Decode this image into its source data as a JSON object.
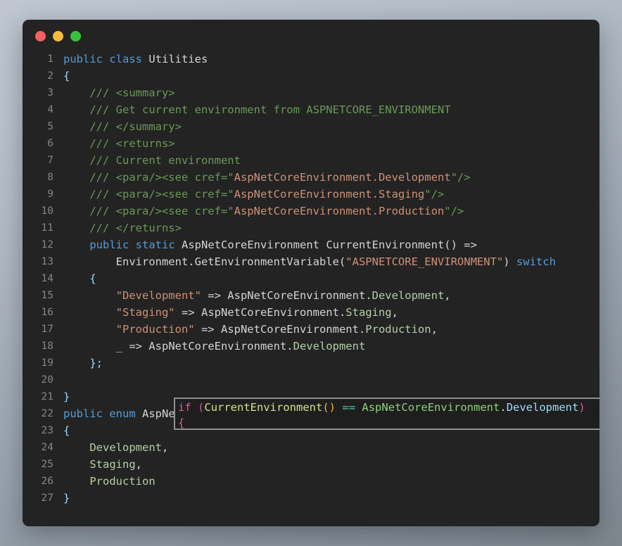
{
  "window": {
    "name": "code-snippet-window",
    "traffic_lights": [
      {
        "name": "close-button",
        "color": "#f1605f"
      },
      {
        "name": "minimize-button",
        "color": "#f5bd3a"
      },
      {
        "name": "maximize-button",
        "color": "#39c13c"
      }
    ],
    "background": "#232323"
  },
  "theme": {
    "background": "#232323",
    "gutter": "#858585",
    "text": "#d4d4d4",
    "keyword": "#569cd6",
    "comment": "#6a9955",
    "string": "#ce9178",
    "enum_member": "#b5cea8",
    "parameter": "#9cdcfe"
  },
  "editor": {
    "language": "csharp",
    "first_line_number": 1,
    "last_line_number": 27,
    "lines": [
      {
        "n": "1",
        "tokens": [
          {
            "t": "public",
            "c": "k"
          },
          {
            "t": " ",
            "c": "op"
          },
          {
            "t": "class",
            "c": "k"
          },
          {
            "t": " ",
            "c": "op"
          },
          {
            "t": "Utilities",
            "c": "ty"
          }
        ]
      },
      {
        "n": "2",
        "tokens": [
          {
            "t": "{",
            "c": "pn"
          }
        ]
      },
      {
        "n": "3",
        "tokens": [
          {
            "t": "    /// ",
            "c": "cm"
          },
          {
            "t": "<summary>",
            "c": "cm"
          }
        ]
      },
      {
        "n": "4",
        "tokens": [
          {
            "t": "    /// Get current environment from ASPNETCORE_ENVIRONMENT",
            "c": "cm"
          }
        ]
      },
      {
        "n": "5",
        "tokens": [
          {
            "t": "    /// </summary>",
            "c": "cm"
          }
        ]
      },
      {
        "n": "6",
        "tokens": [
          {
            "t": "    /// <returns>",
            "c": "cm"
          }
        ]
      },
      {
        "n": "7",
        "tokens": [
          {
            "t": "    /// Current environment",
            "c": "cm"
          }
        ]
      },
      {
        "n": "8",
        "tokens": [
          {
            "t": "    /// <para/><see cref=\"",
            "c": "cm"
          },
          {
            "t": "AspNetCoreEnvironment.Development",
            "c": "str"
          },
          {
            "t": "\"/>",
            "c": "cm"
          }
        ]
      },
      {
        "n": "9",
        "tokens": [
          {
            "t": "    /// <para/><see cref=\"",
            "c": "cm"
          },
          {
            "t": "AspNetCoreEnvironment.Staging",
            "c": "str"
          },
          {
            "t": "\"/>",
            "c": "cm"
          }
        ]
      },
      {
        "n": "10",
        "tokens": [
          {
            "t": "    /// <para/><see cref=\"",
            "c": "cm"
          },
          {
            "t": "AspNetCoreEnvironment.Production",
            "c": "str"
          },
          {
            "t": "\"/>",
            "c": "cm"
          }
        ]
      },
      {
        "n": "11",
        "tokens": [
          {
            "t": "    /// </returns>",
            "c": "cm"
          }
        ]
      },
      {
        "n": "12",
        "tokens": [
          {
            "t": "    ",
            "c": "op"
          },
          {
            "t": "public",
            "c": "k"
          },
          {
            "t": " ",
            "c": "op"
          },
          {
            "t": "static",
            "c": "k"
          },
          {
            "t": " ",
            "c": "op"
          },
          {
            "t": "AspNetCoreEnvironment CurrentEnvironment() =>",
            "c": "ty"
          }
        ]
      },
      {
        "n": "13",
        "tokens": [
          {
            "t": "        Environment.GetEnvironmentVariable(",
            "c": "ty"
          },
          {
            "t": "\"ASPNETCORE_ENVIRONMENT\"",
            "c": "str"
          },
          {
            "t": ") ",
            "c": "ty"
          },
          {
            "t": "switch",
            "c": "k"
          }
        ]
      },
      {
        "n": "14",
        "tokens": [
          {
            "t": "    ",
            "c": "op"
          },
          {
            "t": "{",
            "c": "pn"
          }
        ]
      },
      {
        "n": "15",
        "tokens": [
          {
            "t": "        ",
            "c": "op"
          },
          {
            "t": "\"Development\"",
            "c": "str"
          },
          {
            "t": " => AspNetCoreEnvironment.",
            "c": "ty"
          },
          {
            "t": "Development",
            "c": "enm"
          },
          {
            "t": ",",
            "c": "ty"
          }
        ]
      },
      {
        "n": "16",
        "tokens": [
          {
            "t": "        ",
            "c": "op"
          },
          {
            "t": "\"Staging\"",
            "c": "str"
          },
          {
            "t": " => AspNetCoreEnvironment.",
            "c": "ty"
          },
          {
            "t": "Staging",
            "c": "enm"
          },
          {
            "t": ",",
            "c": "ty"
          }
        ]
      },
      {
        "n": "17",
        "tokens": [
          {
            "t": "        ",
            "c": "op"
          },
          {
            "t": "\"Production\"",
            "c": "str"
          },
          {
            "t": " => AspNetCoreEnvironment.",
            "c": "ty"
          },
          {
            "t": "Production",
            "c": "enm"
          },
          {
            "t": ",",
            "c": "ty"
          }
        ]
      },
      {
        "n": "18",
        "tokens": [
          {
            "t": "        ",
            "c": "op"
          },
          {
            "t": "_",
            "c": "pn"
          },
          {
            "t": " => AspNetCoreEnvironment.",
            "c": "ty"
          },
          {
            "t": "Development",
            "c": "enm"
          }
        ]
      },
      {
        "n": "19",
        "tokens": [
          {
            "t": "    };",
            "c": "pn"
          }
        ]
      },
      {
        "n": "20",
        "tokens": [
          {
            "t": " ",
            "c": "op"
          }
        ]
      },
      {
        "n": "21",
        "tokens": [
          {
            "t": "}",
            "c": "pn"
          }
        ]
      },
      {
        "n": "22",
        "tokens": [
          {
            "t": "public",
            "c": "k"
          },
          {
            "t": " ",
            "c": "op"
          },
          {
            "t": "enum",
            "c": "k"
          },
          {
            "t": " ",
            "c": "op"
          },
          {
            "t": "AspNetCoreEnvironment",
            "c": "ty"
          }
        ]
      },
      {
        "n": "23",
        "tokens": [
          {
            "t": "{",
            "c": "pn"
          }
        ]
      },
      {
        "n": "24",
        "tokens": [
          {
            "t": "    ",
            "c": "op"
          },
          {
            "t": "Development",
            "c": "enm"
          },
          {
            "t": ",",
            "c": "ty"
          }
        ]
      },
      {
        "n": "25",
        "tokens": [
          {
            "t": "    ",
            "c": "op"
          },
          {
            "t": "Staging",
            "c": "enm"
          },
          {
            "t": ",",
            "c": "ty"
          }
        ]
      },
      {
        "n": "26",
        "tokens": [
          {
            "t": "    ",
            "c": "op"
          },
          {
            "t": "Production",
            "c": "enm"
          }
        ]
      },
      {
        "n": "27",
        "tokens": [
          {
            "t": "}",
            "c": "pn"
          }
        ]
      }
    ]
  },
  "snippet_overlay": {
    "name": "highlighted-code-snippet",
    "border_color": "#8f8f8f",
    "background": "#1e1e1e",
    "lines": [
      {
        "tokens": [
          {
            "t": "if",
            "c": "s-kw"
          },
          {
            "t": " ",
            "c": ""
          },
          {
            "t": "(",
            "c": "s-par"
          },
          {
            "t": "CurrentEnvironment",
            "c": "s-fn"
          },
          {
            "t": "()",
            "c": "s-ypar"
          },
          {
            "t": " ",
            "c": ""
          },
          {
            "t": "==",
            "c": "s-eq"
          },
          {
            "t": " ",
            "c": ""
          },
          {
            "t": "AspNetCoreEnvironment",
            "c": "s-ty"
          },
          {
            "t": ".",
            "c": "s-dot"
          },
          {
            "t": "Development",
            "c": "s-mem"
          },
          {
            "t": ")",
            "c": "s-par"
          }
        ]
      },
      {
        "tokens": [
          {
            "t": "{",
            "c": "s-brace"
          }
        ]
      }
    ]
  }
}
